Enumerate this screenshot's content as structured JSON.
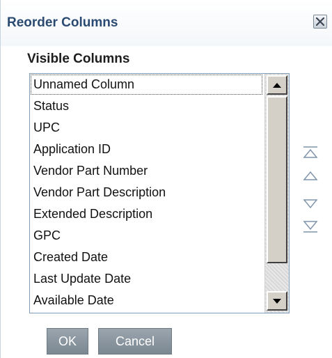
{
  "dialog": {
    "title": "Reorder Columns",
    "close_icon": "close-icon"
  },
  "section": {
    "title": "Visible Columns"
  },
  "columns": [
    "Unnamed Column",
    "Status",
    "UPC",
    "Application ID",
    "Vendor Part Number",
    "Vendor Part Description",
    "Extended Description",
    "GPC",
    "Created Date",
    "Last Update Date",
    "Available Date"
  ],
  "selected_column": "Unnamed Column",
  "reorder_controls": {
    "icons": [
      "move-top-icon",
      "move-up-icon",
      "move-down-icon",
      "move-bottom-icon"
    ]
  },
  "buttons": {
    "ok": "OK",
    "cancel": "Cancel"
  },
  "colors": {
    "title": "#2b4a72",
    "button_bg": "#8a959e",
    "reorder_icon": "#7f95aa"
  }
}
